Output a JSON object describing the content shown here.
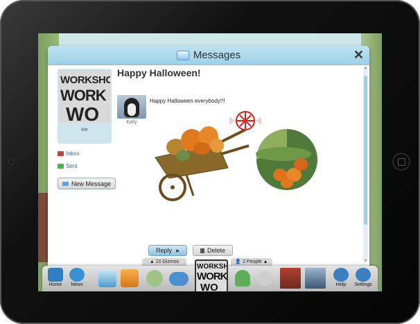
{
  "window": {
    "title": "Messages",
    "close_glyph": "✕"
  },
  "sidebar": {
    "profile": {
      "thumb_lines": [
        "WORKSHO",
        "WORK",
        "WO"
      ],
      "label": "Me"
    },
    "links": [
      {
        "label": "Inbox",
        "icon": "inbox-icon",
        "color": "#b44"
      },
      {
        "label": "Sent",
        "icon": "sent-icon",
        "color": "#5a5"
      }
    ],
    "new_message_label": "New Message"
  },
  "message": {
    "subject": "Happy Halloween!",
    "sender_name": "Kelly",
    "body": "Happy Halloween everybody!!!"
  },
  "actions": {
    "reply_label": "Reply",
    "reply_arrow": "▸",
    "delete_label": "Delete"
  },
  "dock": {
    "gizmos_tab": "▲ 10 Gizmos",
    "people_tab": "👤 2 People ▲",
    "center_lines": [
      "WORKSHO",
      "WORK",
      "WO"
    ],
    "items": [
      {
        "label": "Home",
        "icon": "home-icon"
      },
      {
        "label": "News",
        "icon": "news-icon"
      },
      {
        "label": "",
        "icon": "messages-icon"
      },
      {
        "label": "",
        "icon": "camera-icon"
      },
      {
        "label": "",
        "icon": "add-friend-icon"
      },
      {
        "label": "",
        "icon": "gamepad-icon"
      },
      {
        "label": "",
        "icon": "add-person-icon"
      },
      {
        "label": "",
        "icon": "people-list-icon"
      },
      {
        "label": "",
        "icon": "friend-avatar-icon"
      },
      {
        "label": "",
        "icon": "penguin-avatar-icon"
      },
      {
        "label": "Help",
        "icon": "help-icon"
      },
      {
        "label": "Settings",
        "icon": "settings-icon"
      }
    ]
  },
  "colors": {
    "accent": "#9dd0e6",
    "link": "#2c6aa0"
  }
}
